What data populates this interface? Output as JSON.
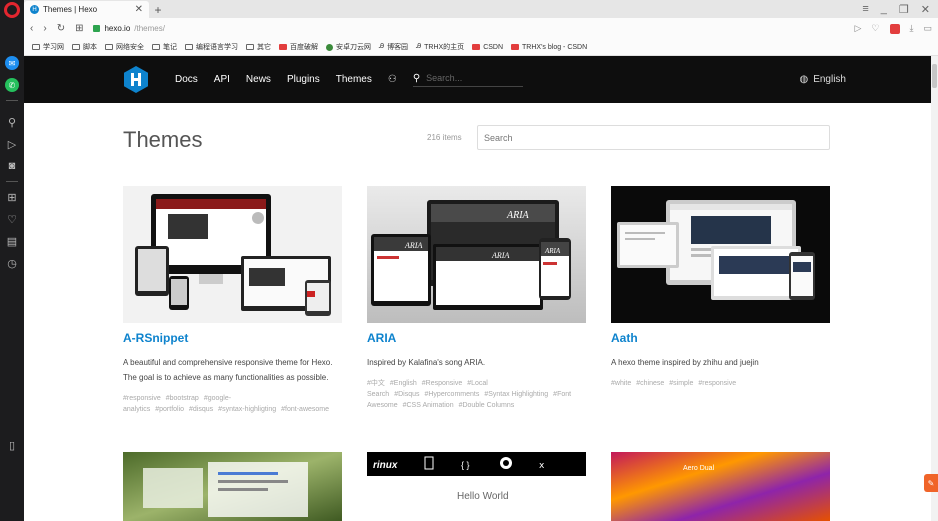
{
  "browser": {
    "tab_title": "Themes | Hexo",
    "new_tab": "+",
    "url_host": "hexo.io",
    "url_path": "/themes/",
    "bookmarks": [
      "学习网",
      "脚本",
      "网络安全",
      "笔记",
      "编程语言学习",
      "其它",
      "百度破解",
      "安卓刀云网",
      "博客园",
      "TRHX的主页",
      "CSDN",
      "TRHX's blog - CSDN"
    ]
  },
  "nav": {
    "links": [
      "Docs",
      "API",
      "News",
      "Plugins",
      "Themes"
    ],
    "search_placeholder": "Search...",
    "language": "English"
  },
  "page": {
    "title": "Themes",
    "count": "216 items",
    "search_placeholder": "Search"
  },
  "cards": [
    {
      "name": "A-RSnippet",
      "description": "A beautiful and comprehensive responsive theme for Hexo. The goal is to achieve as many functionalities as possible.",
      "tags": [
        "#responsive",
        "#bootstrap",
        "#google-analytics",
        "#portfolio",
        "#disqus",
        "#syntax-highligting",
        "#font-awesome"
      ]
    },
    {
      "name": "ARIA",
      "description": "Inspired by Kalafina's song ARIA.",
      "tags": [
        "#中文",
        "#English",
        "#Responsive",
        "#Local Search",
        "#Disqus",
        "#Hypercomments",
        "#Syntax Highlighting",
        "#Font Awesome",
        "#CSS Animation",
        "#Double Columns"
      ]
    },
    {
      "name": "Aath",
      "description": "A hexo theme inspired by zhihu and juejin",
      "tags": [
        "#white",
        "#chinese",
        "#simple",
        "#responsive"
      ]
    }
  ],
  "preview_row2": {
    "middle_text": "Hello World",
    "middle_brand": "rinux",
    "right_text": "Aero Dual"
  },
  "colors": {
    "accent": "#0e83cd",
    "nav_bg": "#0e0e0e",
    "sidebar_bg": "#1c1c1e"
  }
}
